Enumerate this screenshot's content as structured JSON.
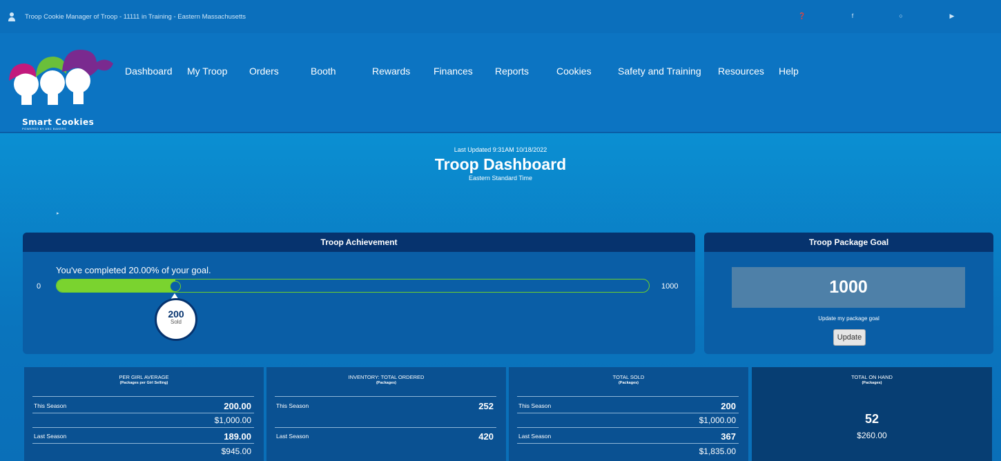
{
  "topbar": {
    "title": "Troop Cookie Manager of Troop - 11111 in Training - Eastern Massachusetts",
    "icons": [
      "user-icon",
      "help-icon",
      "facebook-icon",
      "instagram-icon",
      "youtube-icon"
    ]
  },
  "logo": {
    "text": "Smart Cookies",
    "tagline": "POWERED BY ABC BAKERS"
  },
  "nav": {
    "items": [
      "Dashboard",
      "My Troop",
      "Orders",
      "Booth",
      "Rewards",
      "Finances",
      "Reports",
      "Cookies",
      "Safety and Training",
      "Resources",
      "Help"
    ]
  },
  "header": {
    "last_updated": "Last Updated 9:31AM 10/18/2022",
    "title": "Troop Dashboard",
    "timezone": "Eastern Standard Time"
  },
  "achievement": {
    "title": "Troop Achievement",
    "message": "You've completed 20.00% of your goal.",
    "min": "0",
    "max": "1000",
    "sold": "200",
    "sold_label": "Sold",
    "progress_fraction": 0.2
  },
  "goal": {
    "title": "Troop Package Goal",
    "value": "1000",
    "update_text": "Update my package goal",
    "button_label": "Update"
  },
  "stats": {
    "per_girl": {
      "title": "PER GIRL AVERAGE",
      "subtitle": "(Packages per Girl Selling)",
      "this_label": "This Season",
      "this_value": "200.00",
      "this_money": "$1,000.00",
      "last_label": "Last Season",
      "last_value": "189.00",
      "last_money": "$945.00"
    },
    "inventory": {
      "title": "INVENTORY: TOTAL ORDERED",
      "subtitle": "(Packages)",
      "this_label": "This Season",
      "this_value": "252",
      "last_label": "Last Season",
      "last_value": "420"
    },
    "total_sold": {
      "title": "TOTAL SOLD",
      "subtitle": "(Packages)",
      "this_label": "This Season",
      "this_value": "200",
      "this_money": "$1,000.00",
      "last_label": "Last Season",
      "last_value": "367",
      "last_money": "$1,835.00"
    },
    "on_hand": {
      "title": "TOTAL ON HAND",
      "subtitle": "(Packages)",
      "value": "52",
      "money": "$260.00"
    }
  },
  "colors": {
    "navbar": "#0c74c2",
    "panel_header": "#06336e",
    "progress": "#7ad32f"
  }
}
